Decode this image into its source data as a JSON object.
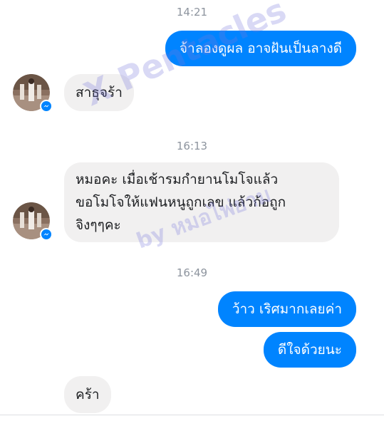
{
  "conversation": {
    "time_1": "14:21",
    "msg_out_1": "จ้าลองดูผล อาจฝันเป็นลางดี",
    "msg_in_1": "สาธุจร้า",
    "time_2": "16:13",
    "msg_in_2_line1": "หมอคะ เมื่อเช้ารมกำยานโมโจแล้ว",
    "msg_in_2_line2": "ขอโมโจให้แฟนหนูถูกเลข แล้วก้อถูก",
    "msg_in_2_line3": "จิงๆๆคะ",
    "time_3": "16:49",
    "msg_out_2": "ว้าว เริศมากเลยค่า",
    "msg_out_3": "ดีใจด้วยนะ",
    "msg_in_3": "คร้า"
  },
  "watermark": {
    "line1": "X Pentacles",
    "line2": "by หมอไพ่ยาม"
  },
  "colors": {
    "outgoing_bubble": "#0084ff",
    "incoming_bubble": "#f1f0f0",
    "timestamp": "#8d949e",
    "messenger_badge": "#0084ff"
  },
  "icons": {
    "avatar": "profile-photo",
    "badge": "messenger-icon"
  }
}
